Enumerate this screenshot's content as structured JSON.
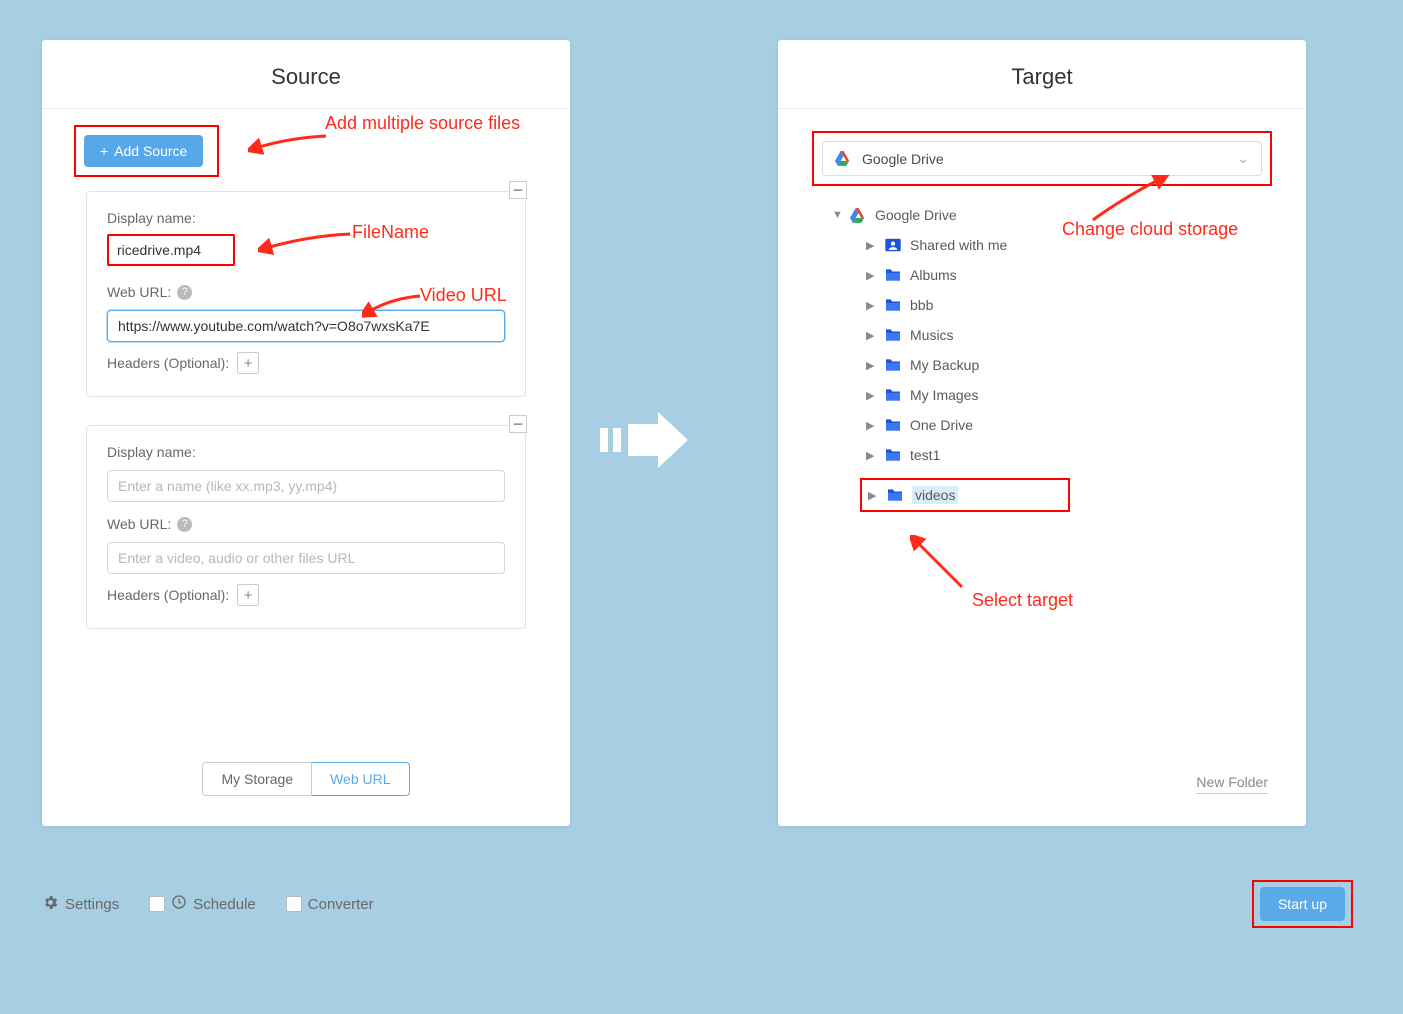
{
  "source": {
    "title": "Source",
    "add_button": "Add Source",
    "cards": [
      {
        "display_name_label": "Display name:",
        "display_name_value": "ricedrive.mp4",
        "web_url_label": "Web URL:",
        "web_url_value": "https://www.youtube.com/watch?v=O8o7wxsKa7E",
        "display_name_placeholder": "",
        "web_url_placeholder": "",
        "headers_label": "Headers (Optional):"
      },
      {
        "display_name_label": "Display name:",
        "display_name_value": "",
        "display_name_placeholder": "Enter a name (like xx.mp3, yy.mp4)",
        "web_url_label": "Web URL:",
        "web_url_value": "",
        "web_url_placeholder": "Enter a video, audio or other files URL",
        "headers_label": "Headers (Optional):"
      }
    ],
    "tabs": {
      "my_storage": "My Storage",
      "web_url": "Web URL"
    }
  },
  "target": {
    "title": "Target",
    "dropdown_label": "Google Drive",
    "root_label": "Google Drive",
    "folders": [
      {
        "name": "Shared with me",
        "icon": "shared"
      },
      {
        "name": "Albums",
        "icon": "folder"
      },
      {
        "name": "bbb",
        "icon": "folder"
      },
      {
        "name": "Musics",
        "icon": "folder"
      },
      {
        "name": "My Backup",
        "icon": "folder"
      },
      {
        "name": "My Images",
        "icon": "folder"
      },
      {
        "name": "One Drive",
        "icon": "folder"
      },
      {
        "name": "test1",
        "icon": "folder"
      },
      {
        "name": "videos",
        "icon": "folder",
        "selected": true
      }
    ],
    "new_folder": "New Folder"
  },
  "bottom": {
    "settings": "Settings",
    "schedule": "Schedule",
    "converter": "Converter",
    "start": "Start up"
  },
  "annotations": {
    "add_multiple": "Add multiple source files",
    "filename": "FileName",
    "video_url": "Video URL",
    "change_cloud": "Change cloud storage",
    "select_target": "Select target"
  }
}
